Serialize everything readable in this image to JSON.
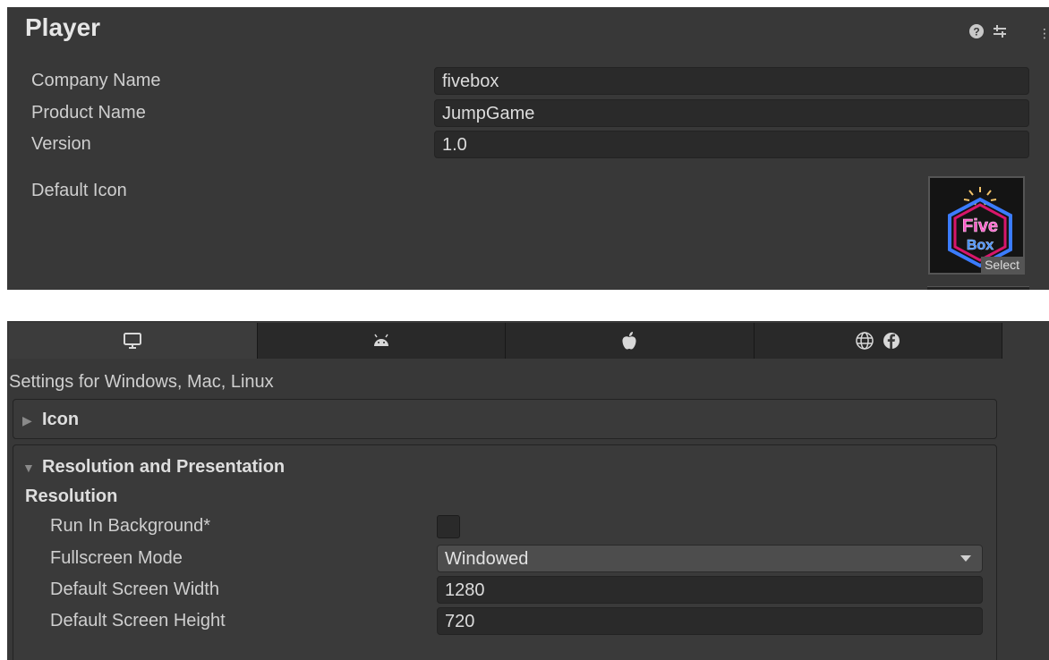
{
  "player": {
    "title": "Player",
    "fields": [
      {
        "label": "Company Name",
        "value": "fivebox"
      },
      {
        "label": "Product Name",
        "value": "JumpGame"
      },
      {
        "label": "Version",
        "value": "1.0"
      }
    ],
    "default_icon_label": "Default Icon",
    "icon_select_label": "Select",
    "icon_logo_text": [
      "Five",
      "Box"
    ]
  },
  "platform": {
    "tabs": [
      {
        "icon": "monitor-icon"
      },
      {
        "icon": "android-icon"
      },
      {
        "icon": "apple-icon"
      },
      {
        "icon": "webgl-facebook-icon"
      }
    ],
    "settings_for": "Settings for Windows, Mac, Linux",
    "sections": {
      "icon": "Icon",
      "resolution_presentation": "Resolution and Presentation",
      "resolution": "Resolution"
    },
    "rows": {
      "run_in_background": "Run In Background*",
      "fullscreen_mode_label": "Fullscreen Mode",
      "fullscreen_mode_value": "Windowed",
      "width_label": "Default Screen Width",
      "width_value": "1280",
      "height_label": "Default Screen Height",
      "height_value": "720"
    }
  }
}
